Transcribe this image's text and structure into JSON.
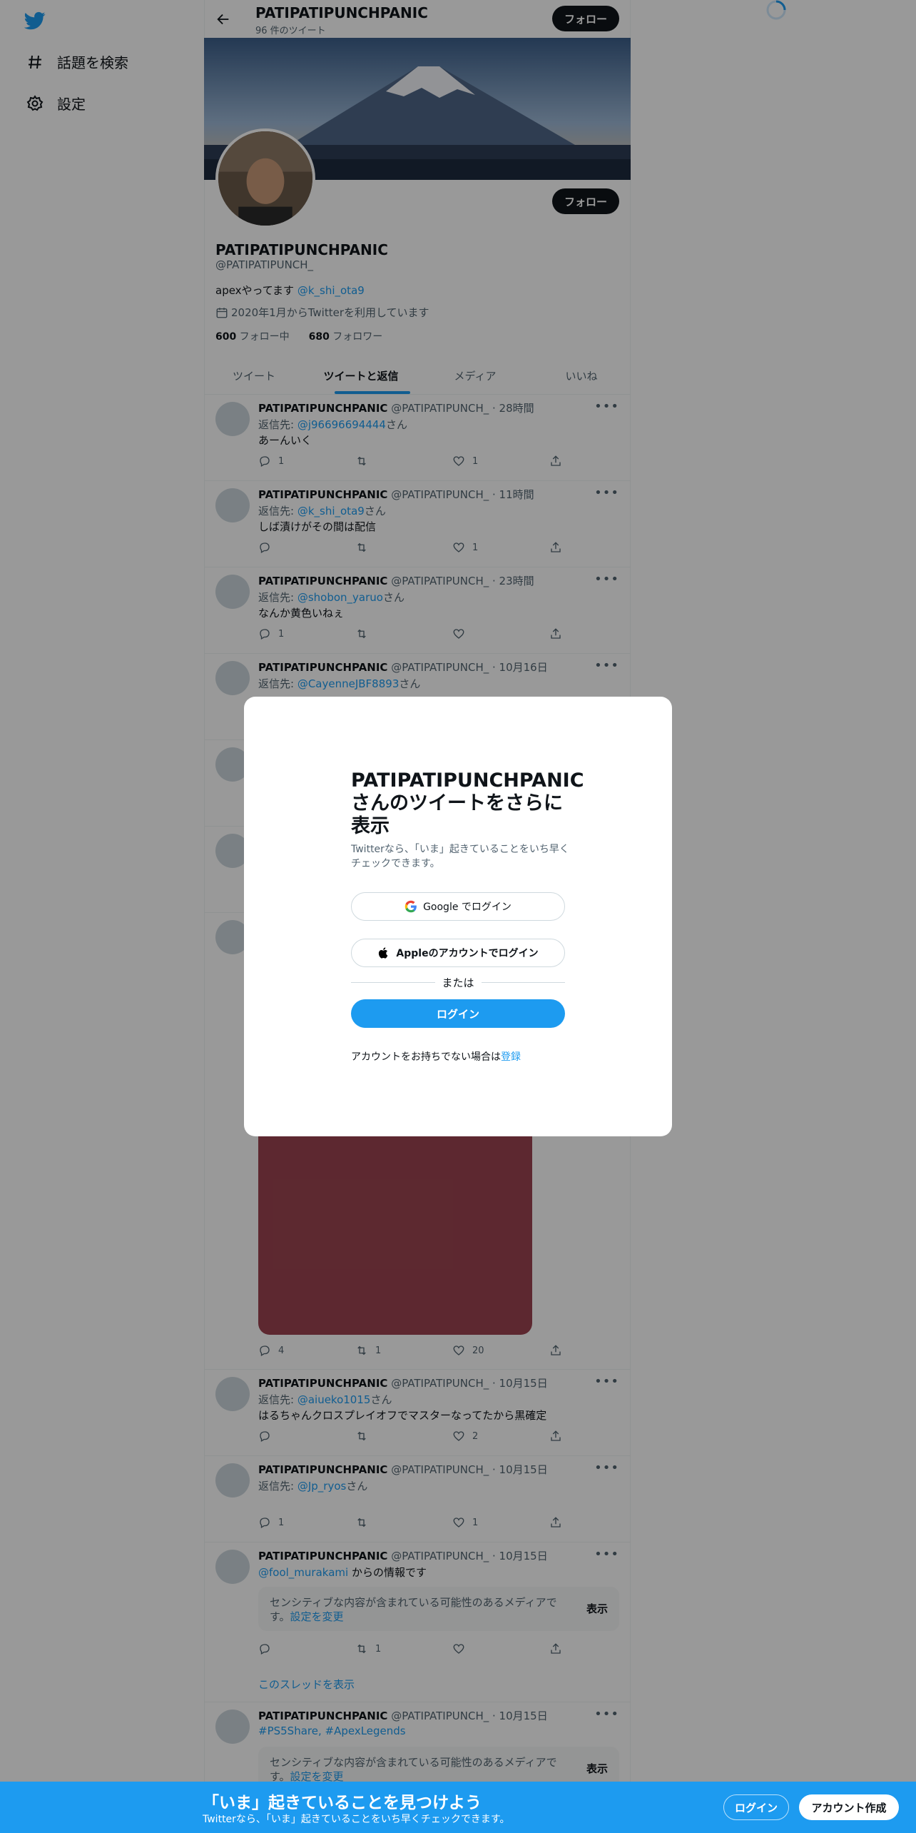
{
  "colors": {
    "accent": "#1d9bf0",
    "text": "#0f1419",
    "secondary": "#536471",
    "overlay": "rgba(0,0,0,0.4)"
  },
  "sidebar": {
    "items": [
      {
        "label": "話題を検索",
        "icon": "hashtag-icon"
      },
      {
        "label": "設定",
        "icon": "gear-icon"
      }
    ]
  },
  "header": {
    "name": "PATIPATIPUNCHPANIC",
    "tweet_count": "96 件のツイート",
    "follow_label": "フォロー"
  },
  "profile": {
    "name": "PATIPATIPUNCHPANIC",
    "handle": "@PATIPATIPUNCH_",
    "bio_text": "apexやってます ",
    "bio_link": "@k_shi_ota9",
    "joined": "2020年1月からTwitterを利用しています",
    "following_count": "600",
    "following_label": " フォロー中",
    "followers_count": "680",
    "followers_label": " フォロワー",
    "follow_label": "フォロー"
  },
  "tabs": [
    {
      "label": "ツイート"
    },
    {
      "label": "ツイートと返信",
      "active": true
    },
    {
      "label": "メディア"
    },
    {
      "label": "いいね"
    }
  ],
  "reply_prefix": "返信先: ",
  "reply_suffix": "さん",
  "tweets": [
    {
      "name": "PATIPATIPUNCHPANIC",
      "handle": "@PATIPATIPUNCH_",
      "time": "28時間",
      "reply_to": "@j96696694444",
      "text": "あーんいく",
      "replies": "1",
      "retweets": "",
      "likes": "1"
    },
    {
      "name": "PATIPATIPUNCHPANIC",
      "handle": "@PATIPATIPUNCH_",
      "time": "11時間",
      "reply_to": "@k_shi_ota9",
      "text": "しば漬けがその間は配信",
      "replies": "",
      "retweets": "",
      "likes": "1"
    },
    {
      "name": "PATIPATIPUNCHPANIC",
      "handle": "@PATIPATIPUNCH_",
      "time": "23時間",
      "reply_to": "@shobon_yaruo",
      "text": "なんか黄色いねぇ",
      "replies": "1",
      "retweets": "",
      "likes": ""
    },
    {
      "name": "PATIPATIPUNCHPANIC",
      "handle": "@PATIPATIPUNCH_",
      "time": "10月16日",
      "reply_to": "@CayenneJBF8893",
      "text": "",
      "replies": "",
      "retweets": "",
      "likes": ""
    }
  ],
  "media_tweet": {
    "replies": "4",
    "retweets": "1",
    "likes": "20"
  },
  "tweets_lower": [
    {
      "name": "PATIPATIPUNCHPANIC",
      "handle": "@PATIPATIPUNCH_",
      "time": "10月15日",
      "reply_to": "@aiueko1015",
      "text": "はるちゃんクロスプレイオフでマスターなってたから黒確定",
      "replies": "",
      "retweets": "",
      "likes": "2"
    },
    {
      "name": "PATIPATIPUNCHPANIC",
      "handle": "@PATIPATIPUNCH_",
      "time": "10月15日",
      "reply_to": "@Jp_ryos",
      "text": "",
      "replies": "1",
      "retweets": "",
      "likes": "1"
    }
  ],
  "tweet_info": {
    "name": "PATIPATIPUNCHPANIC",
    "handle": "@PATIPATIPUNCH_",
    "time": "10月15日",
    "mention": "@fool_murakami",
    "text_after": " からの情報です",
    "sensitive_text": "センシティブな内容が含まれている可能性のあるメディアです。",
    "change_settings": "設定を変更",
    "show_label": "表示",
    "replies": "",
    "retweets": "1",
    "likes": "",
    "thread_link": "このスレッドを表示"
  },
  "tweet_last": {
    "name": "PATIPATIPUNCHPANIC",
    "handle": "@PATIPATIPUNCH_",
    "time": "10月15日",
    "hashtags": "#PS5Share, #ApexLegends",
    "sensitive_text": "センシティブな内容が含まれている可能性のあるメディアです。",
    "change_settings": "設定を変更",
    "show_label": "表示"
  },
  "modal": {
    "title": "PATIPATIPUNCHPANICさんのツイートをさらに表示",
    "subtitle": "Twitterなら、「いま」起きていることをいち早くチェックできます。",
    "google_label": "Google でログイン",
    "apple_label": "Appleのアカウントでログイン",
    "or_label": "または",
    "login_label": "ログイン",
    "signup_prefix": "アカウントをお持ちでない場合は",
    "signup_link": "登録"
  },
  "bottom_bar": {
    "title": "「いま」起きていることを見つけよう",
    "subtitle": "Twitterなら、「いま」起きていることをいち早くチェックできます。",
    "login_label": "ログイン",
    "signup_label": "アカウント作成"
  }
}
